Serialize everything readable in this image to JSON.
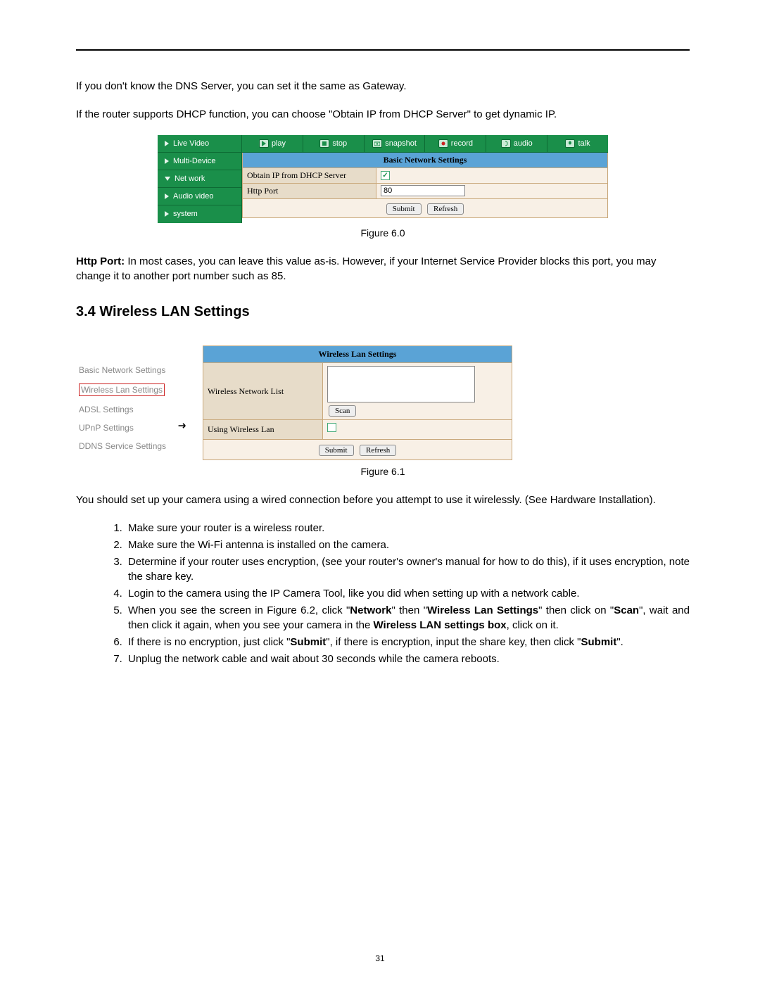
{
  "intro": {
    "p1": "If you don't know the DNS Server, you can set it the same as Gateway.",
    "p2": "If the router supports DHCP function, you can choose \"Obtain IP from DHCP Server\" to get dynamic IP."
  },
  "fig60": {
    "sidebar": [
      {
        "label": "Live Video",
        "icon": "right"
      },
      {
        "label": "Multi-Device",
        "icon": "right"
      },
      {
        "label": "Net work",
        "icon": "down"
      },
      {
        "label": "Audio video",
        "icon": "right"
      },
      {
        "label": "system",
        "icon": "right"
      }
    ],
    "toolbar": [
      {
        "label": "play",
        "icon": "play"
      },
      {
        "label": "stop",
        "icon": "stop"
      },
      {
        "label": "snapshot",
        "icon": "snapshot"
      },
      {
        "label": "record",
        "icon": "record"
      },
      {
        "label": "audio",
        "icon": "audio"
      },
      {
        "label": "talk",
        "icon": "talk"
      }
    ],
    "panel": {
      "header": "Basic Network Settings",
      "row_dhcp_label": "Obtain IP from DHCP Server",
      "row_dhcp_checked": true,
      "row_port_label": "Http Port",
      "row_port_value": "80",
      "submit": "Submit",
      "refresh": "Refresh"
    },
    "caption": "Figure 6.0"
  },
  "http_port_para": {
    "lead": "Http Port: ",
    "rest": "In most cases, you can leave this value as-is. However, if your Internet Service Provider blocks this port, you may change it to another port number such as 85."
  },
  "section_3_4": "3.4   Wireless LAN Settings",
  "fig61": {
    "links": [
      "Basic Network Settings",
      "Wireless Lan Settings",
      "ADSL Settings",
      "UPnP Settings",
      "DDNS Service Settings"
    ],
    "selected_index": 1,
    "panel": {
      "header": "Wireless Lan Settings",
      "row_list_label": "Wireless Network List",
      "scan": "Scan",
      "row_using_label": "Using Wireless Lan",
      "using_checked": false,
      "submit": "Submit",
      "refresh": "Refresh"
    },
    "caption": "Figure 6.1"
  },
  "wired_para": "You should set up your camera using a wired connection before you attempt to use it wirelessly. (See Hardware Installation).",
  "steps": [
    {
      "text": "Make sure your router is a wireless router."
    },
    {
      "text": "Make sure the Wi-Fi antenna is installed on the camera."
    },
    {
      "text": "Determine if your router uses encryption, (see your router's owner's manual for how to do this), if it uses encryption, note the share key."
    },
    {
      "text": "Login to the camera using the IP Camera Tool, like you did when setting up with a network cable."
    },
    {
      "html": "When you see the screen in Figure 6.2, click \"<b>Network</b>\" then \"<b>Wireless Lan Settings</b>\" then click on \"<b>Scan</b>\", wait and then click it again, when you see your camera in the <b>Wireless LAN settings box</b>, click on it."
    },
    {
      "html": "If there is no encryption, just click \"<b>Submit</b>\", if there is encryption, input the share key, then click \"<b>Submit</b>\"."
    },
    {
      "text": "Unplug the network cable and wait about 30 seconds while the camera reboots."
    }
  ],
  "page_number": "31"
}
